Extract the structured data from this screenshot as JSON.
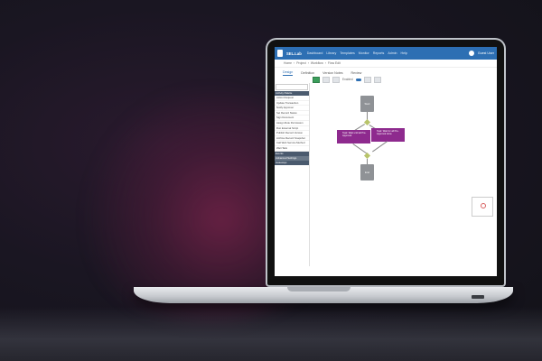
{
  "topbar": {
    "app_name": "SEL.Lab",
    "nav": [
      "Dashboard",
      "Library",
      "Templates",
      "Monitor",
      "Reports",
      "Admin",
      "Help",
      "Help"
    ],
    "user": "Guest User"
  },
  "breadcrumb": [
    "Home",
    "Project",
    "Workflow",
    "Flow Edit"
  ],
  "tabs": [
    "Design",
    "Definition",
    "Version Notes",
    "Review"
  ],
  "toolbar": {
    "save_label": "Save",
    "toggle_label": "Enabled"
  },
  "sidebar": {
    "search_placeholder": "Search...",
    "header_1": "Activity Palette",
    "items": [
      "Action Request",
      "Update Transaction",
      "Notify Approver",
      "Set Record Status",
      "Sign Document",
      "Assign Role Permission",
      "Run External Script",
      "Publish Record Version",
      "Archive Record Snapshot",
      "Call Web Service Method",
      "Wait Task"
    ],
    "header_2": "Events",
    "header_3": "Advanced Settings",
    "header_4": "Gateways"
  },
  "canvas": {
    "start_label": "Start",
    "end_label": "End",
    "task_a": "Task: Wait until all Pre-Approval",
    "task_b": "Task: Wait for all Pre-Approval done"
  },
  "colors": {
    "topbar": "#2d6fb3",
    "task_node": "#8e2a8e",
    "gateway": "#b8c46a",
    "event_node": "#8f9296"
  }
}
